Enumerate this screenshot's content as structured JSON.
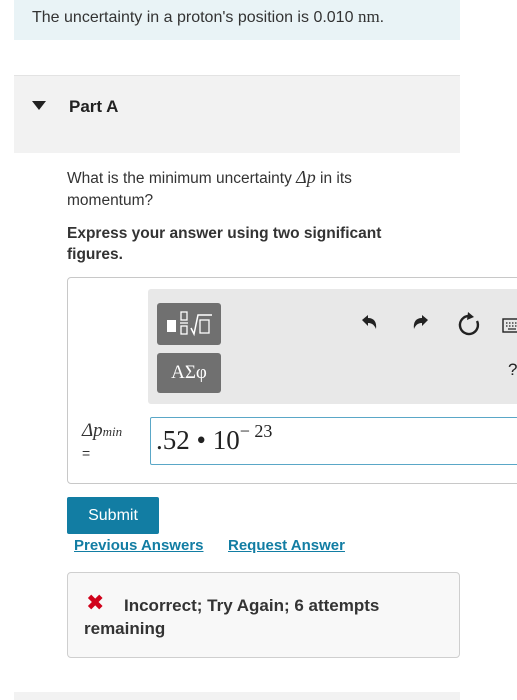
{
  "problem": {
    "text_before": "The uncertainty in a proton's position is ",
    "value": "0.010",
    "unit": "nm",
    "text_after": "."
  },
  "part": {
    "title": "Part A",
    "question_before": "What is the minimum uncertainty ",
    "question_symbol": "Δp",
    "question_after": " in its momentum?",
    "instruction": "Express your answer using two significant figures."
  },
  "toolbar": {
    "templates_icon": "fraction-sqrt-template-icon",
    "greek_label": "ΑΣφ",
    "undo_icon": "undo-icon",
    "redo_icon": "redo-icon",
    "reset_icon": "reset-icon",
    "keyboard_icon": "keyboard-icon",
    "help_icon": "help-icon"
  },
  "answer": {
    "label_symbol": "Δp",
    "label_subscript": "min",
    "label_eq": "=",
    "mantissa": ".52",
    "times": " • ",
    "base": "10",
    "exponent": "− 23"
  },
  "actions": {
    "submit": "Submit",
    "previous_answers": "Previous Answers",
    "request_answer": "Request Answer"
  },
  "feedback": {
    "icon": "x-mark-icon",
    "text": "Incorrect; Try Again; 6 attempts remaining",
    "color": "#d0021b"
  },
  "colors": {
    "accent": "#127da3",
    "problem_bg": "#e9f3f6",
    "header_bg": "#f2f2f2"
  }
}
